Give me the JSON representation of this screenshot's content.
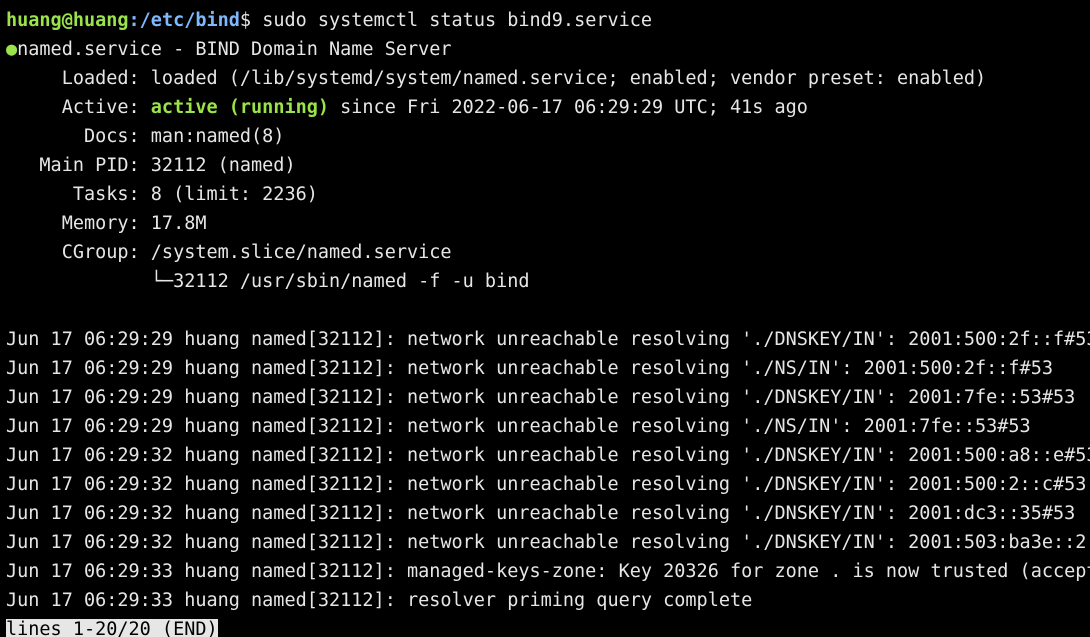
{
  "prompt": {
    "user_host": "huang@huang",
    "separator": ":",
    "path": "/etc/bind",
    "symbol": "$",
    "command": " sudo systemctl status bind9.service"
  },
  "status": {
    "dot": "●",
    "title": "named.service - BIND Domain Name Server",
    "loaded": "     Loaded: loaded (/lib/systemd/system/named.service; enabled; vendor preset: enabled)",
    "active_label": "     Active: ",
    "active_state": "active (running)",
    "active_rest": " since Fri 2022-06-17 06:29:29 UTC; 41s ago",
    "docs": "       Docs: man:named(8)",
    "main_pid": "   Main PID: 32112 (named)",
    "tasks": "      Tasks: 8 (limit: 2236)",
    "memory": "     Memory: 17.8M",
    "cgroup": "     CGroup: /system.slice/named.service",
    "cgroup_child": "             └─32112 /usr/sbin/named -f -u bind"
  },
  "logs": [
    {
      "text": "Jun 17 06:29:29 huang named[32112]: network unreachable resolving './DNSKEY/IN': 2001:500:2f::f#53",
      "cut": ""
    },
    {
      "text": "Jun 17 06:29:29 huang named[32112]: network unreachable resolving './NS/IN': 2001:500:2f::f#53",
      "cut": ""
    },
    {
      "text": "Jun 17 06:29:29 huang named[32112]: network unreachable resolving './DNSKEY/IN': 2001:7fe::53#53",
      "cut": ""
    },
    {
      "text": "Jun 17 06:29:29 huang named[32112]: network unreachable resolving './NS/IN': 2001:7fe::53#53",
      "cut": ""
    },
    {
      "text": "Jun 17 06:29:32 huang named[32112]: network unreachable resolving './DNSKEY/IN': 2001:500:a8::e#53",
      "cut": ""
    },
    {
      "text": "Jun 17 06:29:32 huang named[32112]: network unreachable resolving './DNSKEY/IN': 2001:500:2::c#53",
      "cut": ""
    },
    {
      "text": "Jun 17 06:29:32 huang named[32112]: network unreachable resolving './DNSKEY/IN': 2001:dc3::35#53",
      "cut": ""
    },
    {
      "text": "Jun 17 06:29:32 huang named[32112]: network unreachable resolving './DNSKEY/IN': 2001:503:ba3e::2:",
      "cut": ">"
    },
    {
      "text": "Jun 17 06:29:33 huang named[32112]: managed-keys-zone: Key 20326 for zone . is now trusted (accept",
      "cut": ">"
    },
    {
      "text": "Jun 17 06:29:33 huang named[32112]: resolver priming query complete",
      "cut": ""
    }
  ],
  "pager": {
    "status": "lines 1-20/20 (END)"
  },
  "colors": {
    "background": "#000000",
    "foreground": "#e6e6e6",
    "green": "#9be34a",
    "blue": "#7fb8ff"
  }
}
